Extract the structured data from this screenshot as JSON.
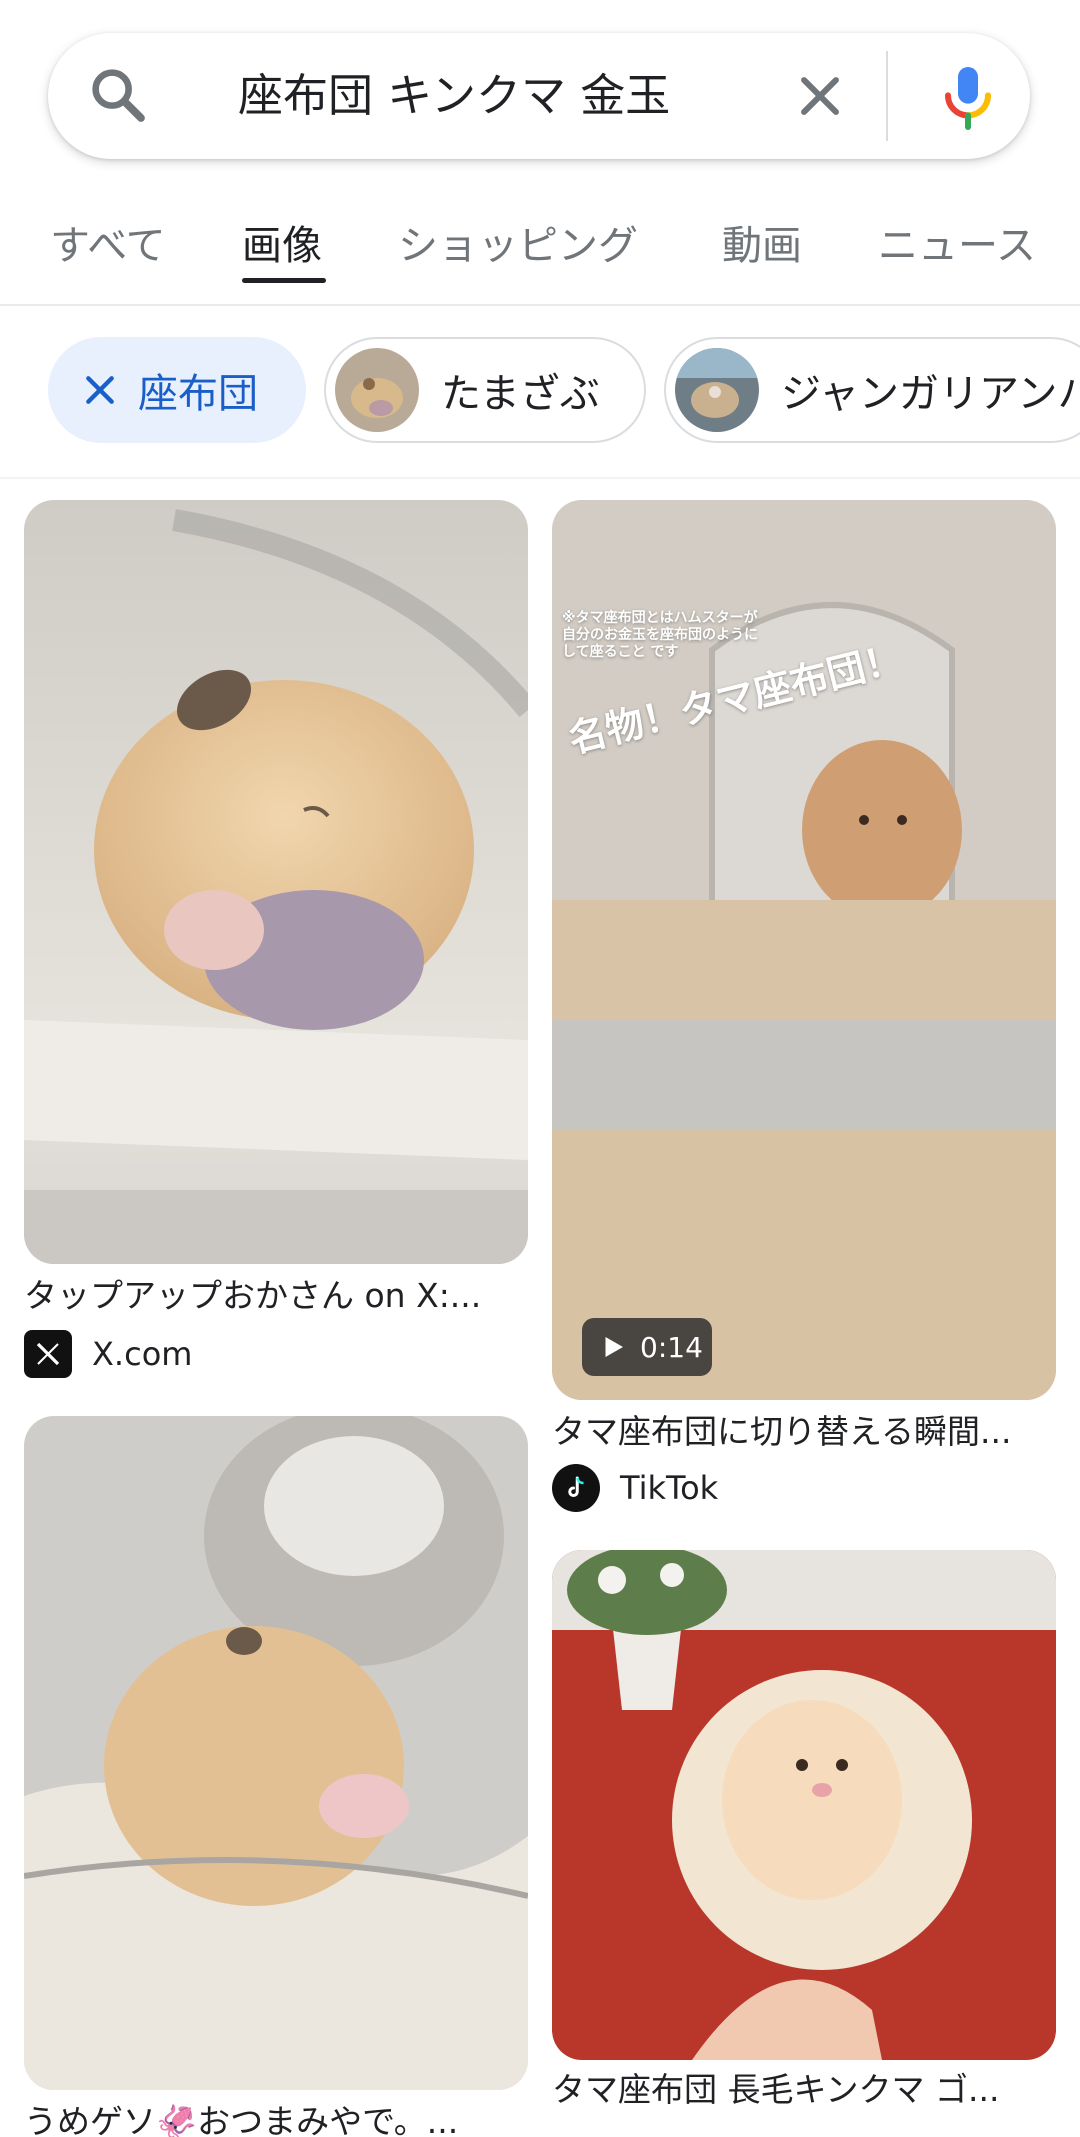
{
  "search": {
    "query": "座布団 キンクマ 金玉"
  },
  "tabs": [
    {
      "label": "すべて",
      "active": false
    },
    {
      "label": "画像",
      "active": true
    },
    {
      "label": "ショッピング",
      "active": false
    },
    {
      "label": "動画",
      "active": false
    },
    {
      "label": "ニュース",
      "active": false
    }
  ],
  "chips": [
    {
      "label": "座布団",
      "selected": true
    },
    {
      "label": "たまざぶ",
      "selected": false
    },
    {
      "label": "ジャンガリアンハムスター",
      "selected": false
    }
  ],
  "results": [
    {
      "caption": "タップアップおかさん on X:...",
      "source": "X.com"
    },
    {
      "caption": "タマ座布団に切り替える瞬間...",
      "source": "TikTok",
      "duration": "0:14",
      "overlay_title": "名物！タマ座布団！",
      "overlay_note": "※タマ座布団とはハムスターが自分のお金玉を座布団のようにして座ること です"
    },
    {
      "caption": "うめゲソ🦑おつまみやで。...",
      "source": ""
    },
    {
      "caption": "タマ座布団 長毛キンクマ ゴ...",
      "source": "..."
    }
  ],
  "colors": {
    "chip_selected_bg": "#e8f0fe",
    "chip_selected_text": "#1a5fc8",
    "mic_blue": "#4285f4",
    "mic_red": "#ea4335",
    "mic_yellow": "#fbbc04",
    "mic_green": "#34a853"
  }
}
